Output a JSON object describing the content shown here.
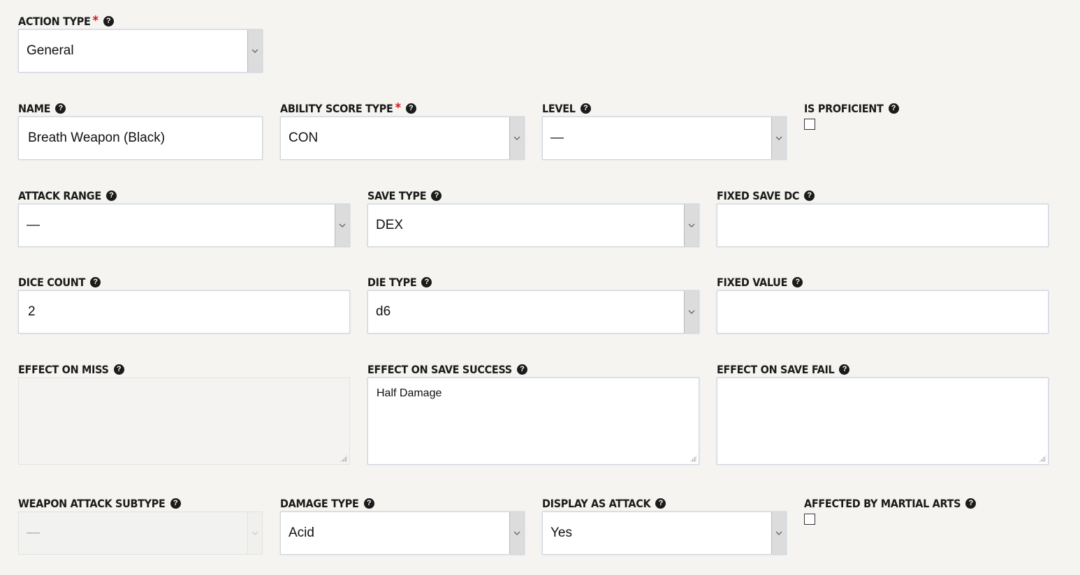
{
  "fields": {
    "action_type": {
      "label": "ACTION TYPE",
      "value": "General"
    },
    "name": {
      "label": "NAME",
      "value": "Breath Weapon (Black)"
    },
    "ability_score_type": {
      "label": "ABILITY SCORE TYPE",
      "value": "CON"
    },
    "level": {
      "label": "LEVEL",
      "value": "—"
    },
    "is_proficient": {
      "label": "IS PROFICIENT",
      "checked": false
    },
    "attack_range": {
      "label": "ATTACK RANGE",
      "value": "—"
    },
    "save_type": {
      "label": "SAVE TYPE",
      "value": "DEX"
    },
    "fixed_save_dc": {
      "label": "FIXED SAVE DC",
      "value": ""
    },
    "dice_count": {
      "label": "DICE COUNT",
      "value": "2"
    },
    "die_type": {
      "label": "DIE TYPE",
      "value": "d6"
    },
    "fixed_value": {
      "label": "FIXED VALUE",
      "value": ""
    },
    "effect_on_miss": {
      "label": "EFFECT ON MISS",
      "value": ""
    },
    "effect_on_save_success": {
      "label": "EFFECT ON SAVE SUCCESS",
      "value": "Half Damage"
    },
    "effect_on_save_fail": {
      "label": "EFFECT ON SAVE FAIL",
      "value": ""
    },
    "weapon_attack_subtype": {
      "label": "WEAPON ATTACK SUBTYPE",
      "value": "—"
    },
    "damage_type": {
      "label": "DAMAGE TYPE",
      "value": "Acid"
    },
    "display_as_attack": {
      "label": "DISPLAY AS ATTACK",
      "value": "Yes"
    },
    "affected_by_martial_arts": {
      "label": "AFFECTED BY MARTIAL ARTS",
      "checked": false
    }
  },
  "required_marker": "*",
  "help_icon": "question-circle-icon",
  "colors": {
    "required": "#d01818",
    "background": "#f5f4f1"
  }
}
